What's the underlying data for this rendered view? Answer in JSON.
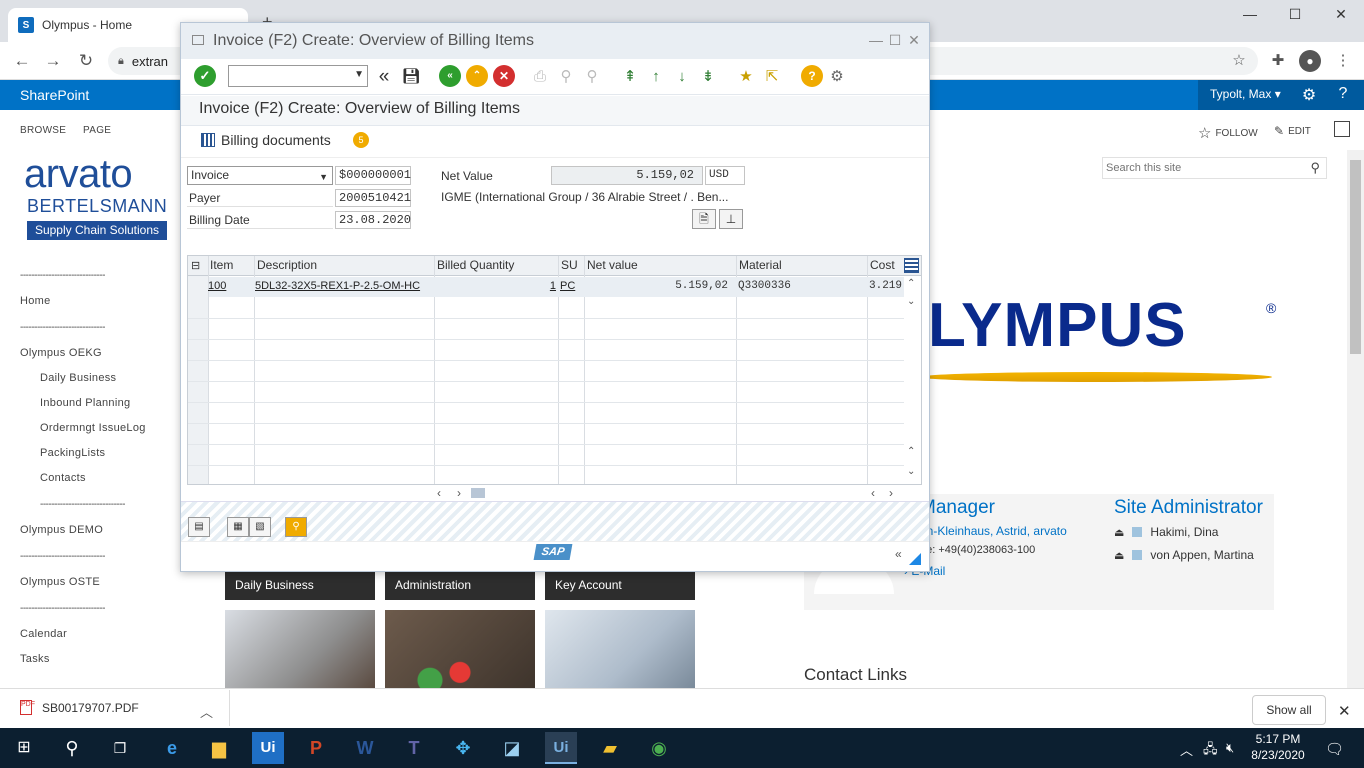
{
  "browser": {
    "tab_title": "Olympus - Home",
    "tab_close": "×",
    "new_tab": "+",
    "url": "extran",
    "win_minimize": "—",
    "win_maximize": "☐",
    "win_close": "✕",
    "icons": [
      "back-arrow-icon",
      "forward-arrow-icon",
      "reload-icon",
      "lock-icon",
      "star-icon",
      "extensions-icon",
      "profile-icon",
      "menu-icon"
    ]
  },
  "sharepoint": {
    "brand": "SharePoint",
    "user": "Typolt, Max ▾",
    "ribbon_tabs": [
      "BROWSE",
      "PAGE"
    ],
    "follow": "FOLLOW",
    "edit": "EDIT",
    "logo": {
      "line1": "arvato",
      "line2": "BERTELSMANN",
      "line3": "Supply Chain Solutions"
    },
    "search_placeholder": "Search this site",
    "nav": [
      {
        "type": "sep",
        "label": "------------------------------"
      },
      {
        "type": "item",
        "label": "Home"
      },
      {
        "type": "sep",
        "label": "------------------------------"
      },
      {
        "type": "item",
        "label": "Olympus OEKG"
      },
      {
        "type": "sub",
        "label": "Daily Business"
      },
      {
        "type": "sub",
        "label": "Inbound Planning"
      },
      {
        "type": "sub",
        "label": "Ordermngt IssueLog"
      },
      {
        "type": "sub",
        "label": "PackingLists"
      },
      {
        "type": "sub",
        "label": "Contacts"
      },
      {
        "type": "subsep",
        "label": "------------------------------"
      },
      {
        "type": "item",
        "label": "Olympus DEMO"
      },
      {
        "type": "sep",
        "label": "------------------------------"
      },
      {
        "type": "item",
        "label": "Olympus OSTE"
      },
      {
        "type": "sep",
        "label": "------------------------------"
      },
      {
        "type": "item",
        "label": "Calendar"
      },
      {
        "type": "item",
        "label": "Tasks"
      }
    ],
    "olympus_logo": "LYMPUS",
    "olympus_reg": "®",
    "manager_title": "Manager",
    "manager_name": "en-Kleinhaus, Astrid, arvato",
    "manager_phone": "ne: +49(40)238063-100",
    "manager_email": "› E-Mail",
    "site_admin_title": "Site Administrator",
    "site_admins": [
      "Hakimi, Dina",
      "von Appen, Martina"
    ],
    "contact_links": "Contact Links",
    "tiles": [
      "Daily Business",
      "Administration",
      "Key Account"
    ]
  },
  "sap": {
    "window_title": "Invoice  (F2) Create: Overview of Billing Items",
    "screen_title": "Invoice  (F2) Create: Overview of Billing Items",
    "billing_documents": "Billing documents",
    "badge": "5",
    "header": {
      "doc_type": "Invoice",
      "doc_number": "$000000001",
      "payer_label": "Payer",
      "payer_value": "2000510421",
      "billing_date_label": "Billing Date",
      "billing_date_value": "23.08.2020",
      "net_value_label": "Net Value",
      "net_value": "5.159,02",
      "currency": "USD",
      "payer_name": "IGME (International Group / 36 Alrabie Street / . Ben..."
    },
    "table": {
      "columns": [
        "Item",
        "Description",
        "Billed Quantity",
        "SU",
        "Net value",
        "Material",
        "Cost"
      ],
      "rows": [
        {
          "item": "100",
          "description": "5DL32-32X5-REX1-P-2.5-OM-HC",
          "qty": "1",
          "su": "PC",
          "net_value": "5.159,02",
          "material": "Q3300336",
          "cost": "3.219"
        }
      ]
    },
    "sap_logo": "SAP"
  },
  "downloads": {
    "file": "SB00179707.PDF",
    "show_all": "Show all"
  },
  "taskbar": {
    "time": "5:17 PM",
    "date": "8/23/2020"
  }
}
